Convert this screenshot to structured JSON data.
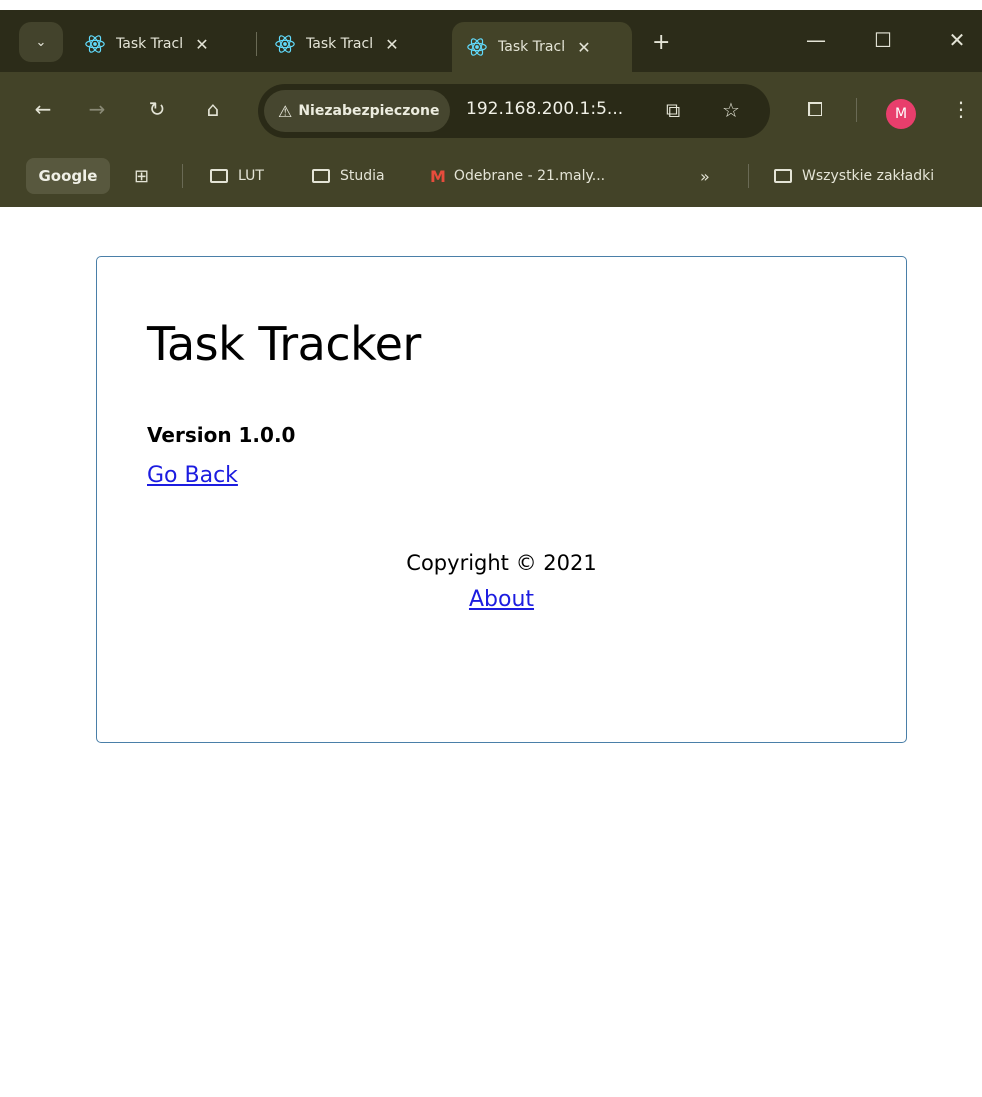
{
  "browser": {
    "tabs": [
      {
        "title": "Task Tracker",
        "active": false
      },
      {
        "title": "Task Tracker",
        "active": false
      },
      {
        "title": "Task Tracker",
        "active": true
      }
    ],
    "security_label": "Niezabezpieczone",
    "url": "192.168.200.1:5...",
    "avatar_letter": "M",
    "bookmarks": {
      "google": "Google",
      "items": [
        "LUT",
        "Studia",
        "Odebrane - 21.maly..."
      ],
      "overflow": "»",
      "all_bookmarks": "Wszystkie zakładki"
    },
    "colors": {
      "accent_avatar": "#e83e6c",
      "frame": "#2c2c19",
      "toolbar": "#434328"
    }
  },
  "page": {
    "title": "Task Tracker",
    "version": "Version 1.0.0",
    "go_back": "Go Back",
    "copyright": "Copyright © 2021",
    "about": "About"
  }
}
